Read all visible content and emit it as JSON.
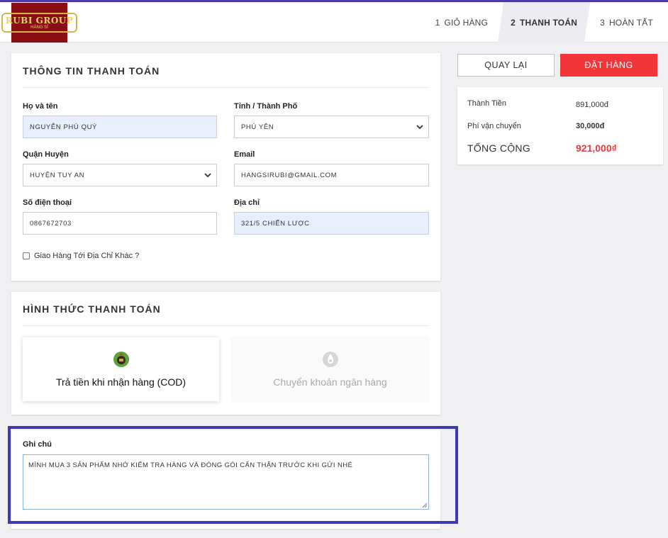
{
  "brand": {
    "logo_text": "RUBI GROUP",
    "logo_sub": "HÀNG SỈ",
    "logo_color": "#8a0f14"
  },
  "steps": [
    {
      "num": "1",
      "label": "GIỎ HÀNG"
    },
    {
      "num": "2",
      "label": "THANH TOÁN"
    },
    {
      "num": "3",
      "label": "HOÀN TẤT"
    }
  ],
  "billing": {
    "title": "THÔNG TIN THANH TOÁN",
    "name_label": "Họ và tên",
    "name_value": "NGUYỄN PHÚ QUÝ",
    "province_label": "Tỉnh / Thành Phố",
    "province_value": "PHÚ YÊN",
    "district_label": "Quận Huyện",
    "district_value": "HUYỆN TUY AN",
    "email_label": "Email",
    "email_value": "HANGSIRUBI@GMAIL.COM",
    "phone_label": "Số điện thoại",
    "phone_value": "0867672703",
    "address_label": "Địa chỉ",
    "address_value": "321/5 CHIẾN LƯỢC",
    "alt_address_label": "Giao Hàng Tới Địa Chỉ Khác ?"
  },
  "payment": {
    "title": "HÌNH THỨC THANH TOÁN",
    "cod_label": "Trả tiền khi nhận hàng (COD)",
    "bank_label": "Chuyển khoản ngân hàng"
  },
  "note": {
    "label": "Ghi chú",
    "value": "MÌNH MUA 3 SẢN PHẨM NHỚ KIỂM TRA HÀNG VÀ ĐÓNG GÓI CẨN THẬN TRƯỚC KHI GỬI NHÉ"
  },
  "actions": {
    "back_label": "QUAY LẠI",
    "order_label": "ĐẶT HÀNG"
  },
  "summary": {
    "subtotal_label": "Thành Tiền",
    "subtotal_value": "891,000đ",
    "shipping_label": "Phí vận chuyển",
    "shipping_value": "30,000đ",
    "total_label": "TỔNG CỘNG",
    "total_value": "921,000₫"
  },
  "colors": {
    "accent": "#f1353a",
    "highlight": "#3e39b8",
    "filled_input": "#e8eefc"
  }
}
